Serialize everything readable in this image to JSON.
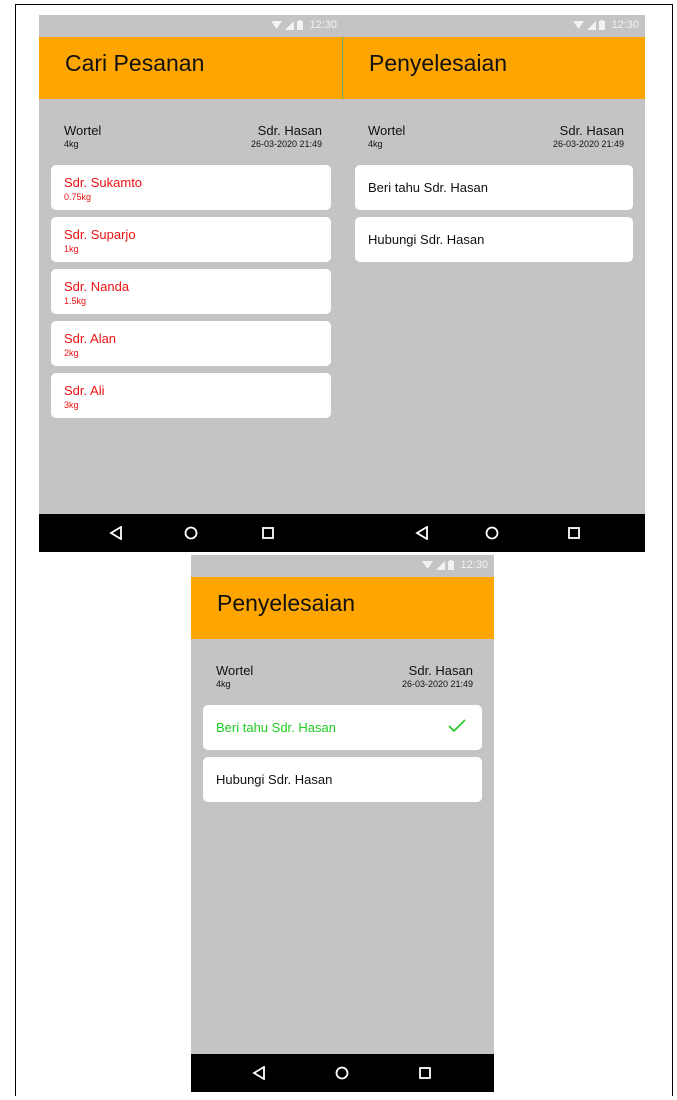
{
  "status": {
    "time": "12:30"
  },
  "screen_search": {
    "title": "Cari Pesanan",
    "product": "Wortel",
    "weight": "4kg",
    "customer": "Sdr. Hasan",
    "datetime": "26-03-2020 21:49",
    "sellers": [
      {
        "name": "Sdr. Sukamto",
        "qty": "0.75kg"
      },
      {
        "name": "Sdr. Suparjo",
        "qty": "1kg"
      },
      {
        "name": "Sdr. Nanda",
        "qty": "1.5kg"
      },
      {
        "name": "Sdr. Alan",
        "qty": "2kg"
      },
      {
        "name": "Sdr. Ali",
        "qty": "3kg"
      }
    ],
    "colors": {
      "seller_text": "#ee1111"
    }
  },
  "screen_finish": {
    "title": "Penyelesaian",
    "product": "Wortel",
    "weight": "4kg",
    "customer": "Sdr. Hasan",
    "datetime": "26-03-2020 21:49",
    "actions": [
      {
        "label": "Beri tahu Sdr. Hasan"
      },
      {
        "label": "Hubungi Sdr. Hasan"
      }
    ]
  },
  "screen_finish_done": {
    "title": "Penyelesaian",
    "product": "Wortel",
    "weight": "4kg",
    "customer": "Sdr. Hasan",
    "datetime": "26-03-2020 21:49",
    "actions": [
      {
        "label": "Beri tahu Sdr. Hasan",
        "done": true,
        "icon": "check-icon"
      },
      {
        "label": "Hubungi Sdr. Hasan"
      }
    ],
    "colors": {
      "done_text": "#22cc22"
    }
  },
  "colors": {
    "appbar": "#ffa500",
    "background": "#c4c4c4",
    "navbar": "#000000"
  },
  "navbar_icons": [
    "back-icon",
    "home-icon",
    "recents-icon"
  ]
}
